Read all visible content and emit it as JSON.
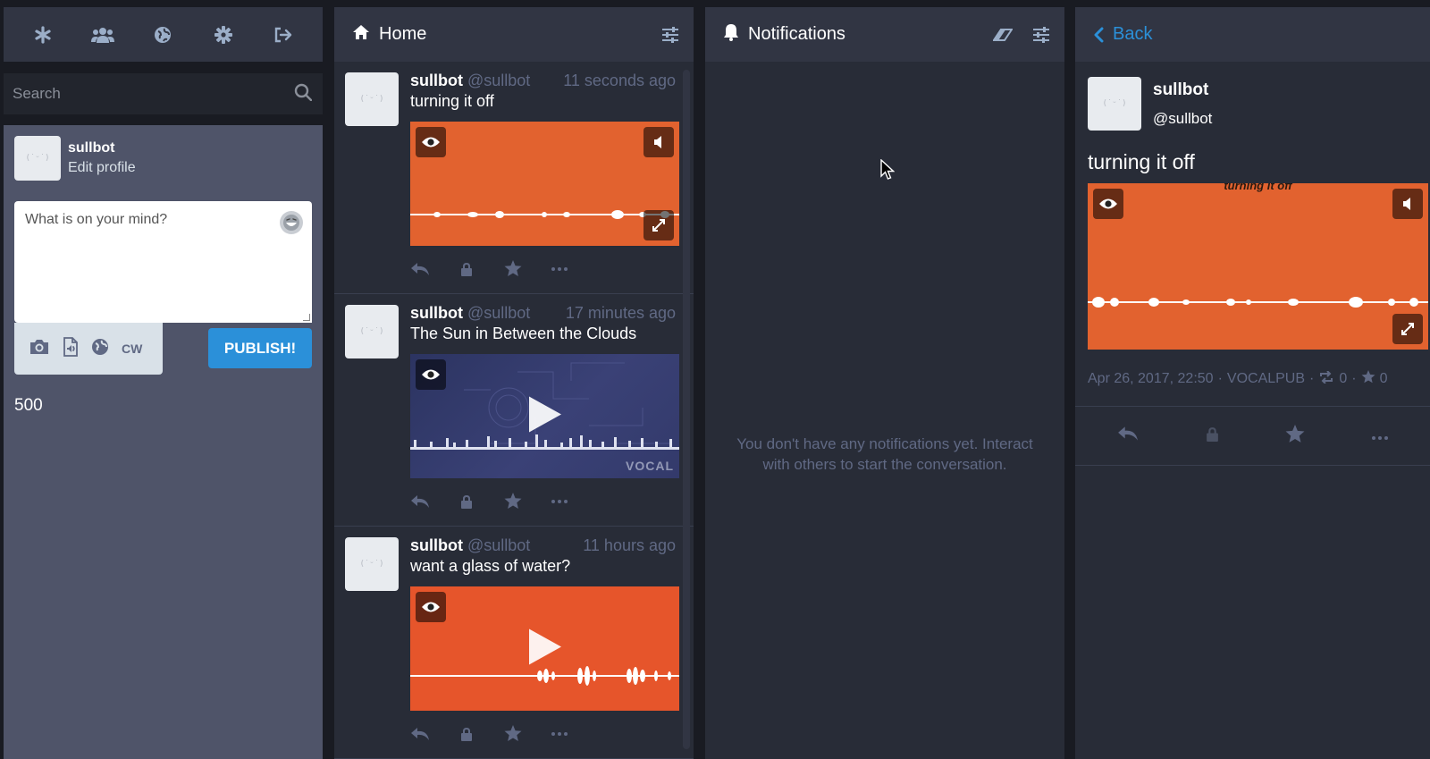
{
  "nav": {
    "items": [
      {
        "name": "getting-started-icon"
      },
      {
        "name": "community-icon"
      },
      {
        "name": "public-timeline-icon"
      },
      {
        "name": "settings-icon"
      },
      {
        "name": "logout-icon"
      }
    ]
  },
  "search": {
    "placeholder": "Search"
  },
  "compose": {
    "display_name": "sullbot",
    "edit_profile": "Edit profile",
    "placeholder": "What is on your mind?",
    "cw_label": "CW",
    "publish_label": "PUBLISH!",
    "char_count": "500"
  },
  "home": {
    "title": "Home",
    "statuses": [
      {
        "name": "sullbot",
        "handle": "@sullbot",
        "time": "11 seconds ago",
        "text": "turning it off",
        "media": "orange-audio"
      },
      {
        "name": "sullbot",
        "handle": "@sullbot",
        "time": "17 minutes ago",
        "text": "The Sun in Between the Clouds",
        "media": "blue-video",
        "watermark": "VOCAL"
      },
      {
        "name": "sullbot",
        "handle": "@sullbot",
        "time": "11 hours ago",
        "text": "want a glass of water?",
        "media": "orange-video"
      }
    ]
  },
  "notifications": {
    "title": "Notifications",
    "empty_message": "You don't have any notifications yet. Interact with others to start the conversation."
  },
  "detail": {
    "back_label": "Back",
    "name": "sullbot",
    "handle": "@sullbot",
    "text": "turning it off",
    "media_caption": "turning it off",
    "date": "Apr 26, 2017, 22:50",
    "app": "VOCALPUB",
    "reblogs": "0",
    "favourites": "0"
  },
  "colors": {
    "accent": "#2b90d9",
    "media_orange": "#e2622f",
    "column_bg": "#282c37",
    "header_bg": "#313543"
  }
}
